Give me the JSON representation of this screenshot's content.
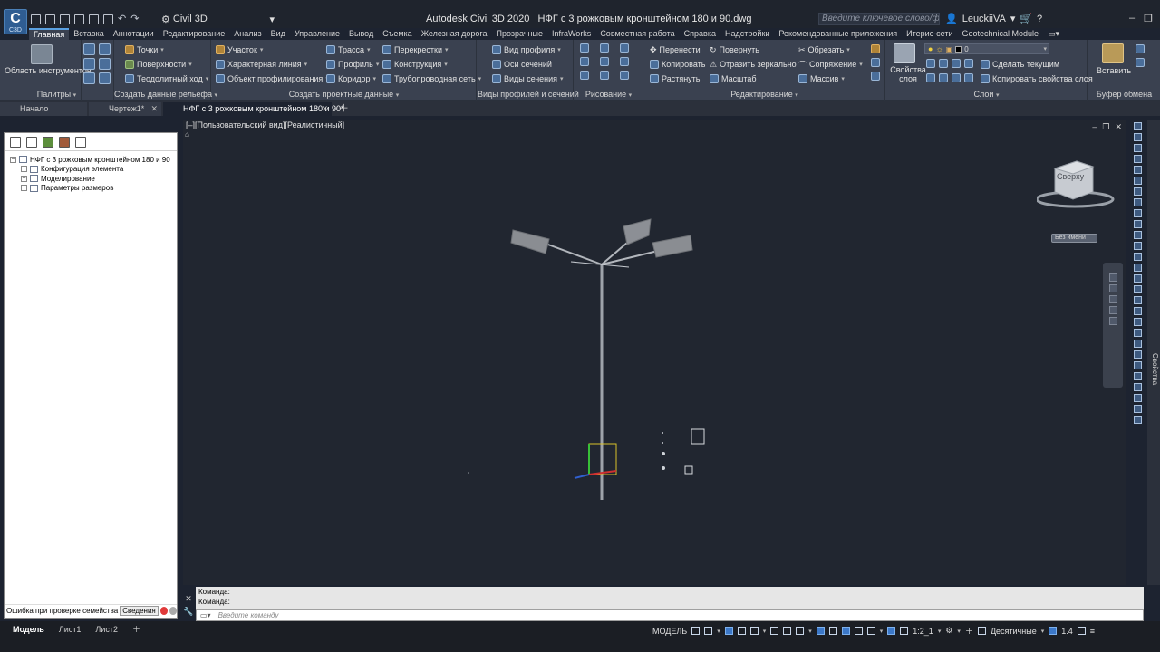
{
  "app": {
    "logo_text": "C",
    "logo_sub": "C3D",
    "workspace": "Civil 3D",
    "title": "Autodesk Civil 3D 2020",
    "document": "НФГ с 3 рожковым кронштейном 180 и 90.dwg",
    "search_placeholder": "Введите ключевое слово/фразу",
    "user": "LeuckiiVA"
  },
  "ribbon_tabs": [
    "Главная",
    "Вставка",
    "Аннотации",
    "Редактирование",
    "Анализ",
    "Вид",
    "Управление",
    "Вывод",
    "Съемка",
    "Железная дорога",
    "Прозрачные",
    "InfraWorks",
    "Совместная работа",
    "Справка",
    "Надстройки",
    "Рекомендованные приложения",
    "Итерис-сети",
    "Geotechnical Module"
  ],
  "ribbon": {
    "palettes": {
      "tool_label": "Область инструментов",
      "title": "Палитры"
    },
    "ground": {
      "items": [
        "Точки",
        "Поверхности",
        "Теодолитный ход"
      ],
      "title": "Создать данные рельефа"
    },
    "design": {
      "col1": [
        "Участок",
        "Характерная линия",
        "Объект профилирования"
      ],
      "col2": [
        "Трасса",
        "Профиль",
        "Коридор"
      ],
      "col3": [
        "Перекрестки",
        "Конструкция",
        "Трубопроводная сеть"
      ],
      "title": "Создать проектные данные"
    },
    "views": {
      "items": [
        "Вид профиля",
        "Оси сечений",
        "Виды сечения"
      ],
      "title": "Виды профилей и сечений"
    },
    "draw": {
      "title": "Рисование"
    },
    "modify": {
      "col1": [
        "Перенести",
        "Копировать",
        "Растянуть"
      ],
      "col2": [
        "Повернуть",
        "Отразить зеркально",
        "Масштаб"
      ],
      "col3": [
        "Обрезать",
        "Сопряжение",
        "Массив"
      ],
      "title": "Редактирование"
    },
    "layers": {
      "props_label": "Свойства слоя",
      "current_layer": "0",
      "items": [
        "Сделать текущим",
        "Копировать свойства слоя"
      ],
      "title": "Слои"
    },
    "clipboard": {
      "paste_label": "Вставить",
      "title": "Буфер обмена"
    }
  },
  "doc_tabs": [
    "Начало",
    "Чертеж1*",
    "НФГ с 3 рожковым кронштейном 180 и 90*"
  ],
  "viewport": {
    "label": "[–][Пользовательский вид][Реалистичный]",
    "viewcube_face": "Сверху",
    "named_view": "Без имени"
  },
  "tree": {
    "root": "НФГ с 3 рожковым кронштейном 180 и 90",
    "children": [
      "Конфигурация элемента",
      "Моделирование",
      "Параметры размеров"
    ]
  },
  "left_status": {
    "error_text": "Ошибка при проверке семейства",
    "details_button": "Сведения"
  },
  "command": {
    "history": [
      "Команда:",
      "Команда:"
    ],
    "placeholder": "Введите команду"
  },
  "layouts": [
    "Модель",
    "Лист1",
    "Лист2"
  ],
  "status": {
    "mode": "МОДЕЛЬ",
    "scale": "1:2_1",
    "units": "Десятичные",
    "lineweight": "1.4"
  },
  "side_panel_label": "Свойства",
  "colors": {
    "bg": "#1d2330",
    "ribbon": "#3a4150",
    "accent": "#5aa0e0",
    "viewport": "#212630"
  }
}
